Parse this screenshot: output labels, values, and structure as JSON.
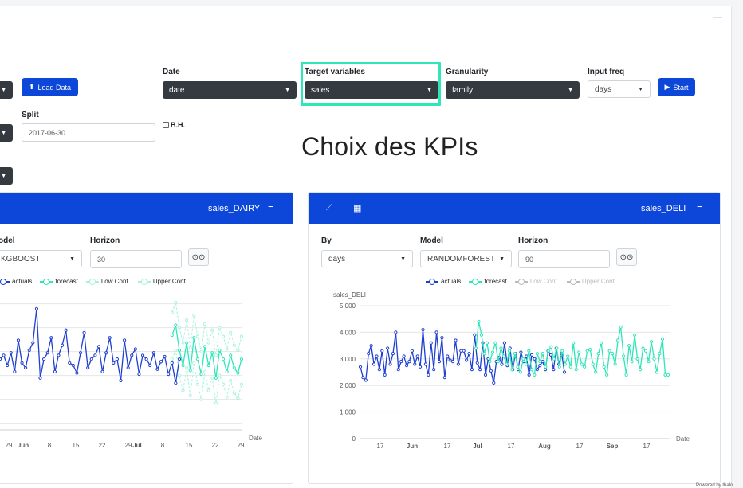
{
  "controls": {
    "load_button": "Load Data",
    "date_label": "Date",
    "date_value": "date",
    "target_label": "Target variables",
    "target_value": "sales",
    "granularity_label": "Granularity",
    "granularity_value": "family",
    "input_freq_label": "Input freq",
    "input_freq_value": "days",
    "start_button": "Start",
    "split_label": "Split",
    "split_value": "2017-06-30",
    "bh_label": "B.H."
  },
  "annotation": "Choix des KPIs",
  "left_panel": {
    "title": "sales_DAIRY",
    "model_label": "odel",
    "model_value": "KGBOOST",
    "horizon_label": "Horizon",
    "horizon_value": "30",
    "legend": [
      "actuals",
      "forecast",
      "Low Conf.",
      "Upper Conf."
    ],
    "x_ticks": [
      "29",
      "Jun",
      "8",
      "15",
      "22",
      "29",
      "Jul",
      "8",
      "15",
      "22",
      "29"
    ],
    "x_axis_title": "Date"
  },
  "right_panel": {
    "title": "sales_DELI",
    "by_label": "By",
    "by_value": "days",
    "model_label": "Model",
    "model_value": "RANDOMFOREST",
    "horizon_label": "Horizon",
    "horizon_value": "90",
    "legend": [
      "actuals",
      "forecast",
      "Low Conf.",
      "Upper Conf."
    ],
    "y_axis_title": "sales_DELI",
    "y_ticks": [
      "5,000",
      "4,000",
      "3,000",
      "2,000",
      "1,000",
      "0"
    ],
    "x_ticks": [
      "17",
      "Jun",
      "17",
      "Jul",
      "17",
      "Aug",
      "17",
      "Sep",
      "17"
    ],
    "x_axis_title": "Date"
  },
  "footer": {
    "powered_by": "Powered by thalo"
  },
  "colors": {
    "accent": "#0d47d9",
    "actuals": "#1f3fd1",
    "forecast": "#2ee6b8",
    "conf": "#a8f2dd",
    "conf_grey": "#bbbbbb"
  },
  "chart_data": [
    {
      "type": "line",
      "title": "sales_DAIRY",
      "xlabel": "Date",
      "series": [
        {
          "name": "actuals",
          "values": [
            0.55,
            0.58,
            0.5,
            0.6,
            0.45,
            0.7,
            0.52,
            0.48,
            0.62,
            0.68,
            0.95,
            0.4,
            0.55,
            0.6,
            0.72,
            0.45,
            0.58,
            0.66,
            0.78,
            0.52,
            0.5,
            0.44,
            0.6,
            0.76,
            0.48,
            0.55,
            0.58,
            0.65,
            0.45,
            0.6,
            0.72,
            0.52,
            0.55,
            0.38,
            0.7,
            0.48,
            0.58,
            0.63,
            0.43,
            0.58,
            0.55,
            0.5,
            0.6,
            0.47,
            0.53,
            0.57,
            0.43,
            0.52,
            0.36,
            0.55
          ]
        },
        {
          "name": "forecast",
          "values": [
            0.74,
            0.82,
            0.62,
            0.5,
            0.68,
            0.46,
            0.72,
            0.55,
            0.43,
            0.65,
            0.5,
            0.6,
            0.4,
            0.62,
            0.55,
            0.45,
            0.58,
            0.48,
            0.44,
            0.55
          ]
        },
        {
          "name": "Low Conf.",
          "values": [
            0.55,
            0.62,
            0.42,
            0.3,
            0.48,
            0.26,
            0.52,
            0.35,
            0.23,
            0.45,
            0.3,
            0.4,
            0.2,
            0.42,
            0.35,
            0.25,
            0.38,
            0.28,
            0.24,
            0.35
          ]
        },
        {
          "name": "Upper Conf.",
          "values": [
            0.92,
            1.0,
            0.8,
            0.68,
            0.86,
            0.64,
            0.9,
            0.73,
            0.61,
            0.83,
            0.68,
            0.78,
            0.58,
            0.8,
            0.73,
            0.63,
            0.76,
            0.66,
            0.62,
            0.73
          ]
        }
      ]
    },
    {
      "type": "line",
      "title": "sales_DELI",
      "ylabel": "sales_DELI",
      "xlabel": "Date",
      "ylim": [
        0,
        5000
      ],
      "series": [
        {
          "name": "actuals",
          "values": [
            2700,
            2300,
            2200,
            3200,
            3500,
            2800,
            3100,
            2600,
            3300,
            2400,
            3400,
            2800,
            3200,
            4000,
            2600,
            2900,
            3100,
            2750,
            2900,
            3300,
            2800,
            3100,
            2700,
            4100,
            2800,
            2400,
            3600,
            2600,
            4000,
            2900,
            3800,
            2300,
            3100,
            2950,
            2900,
            3700,
            2800,
            3300,
            3300,
            2950,
            3200,
            2600,
            3900,
            2850,
            2600,
            3600,
            2400,
            3000,
            2550,
            2100,
            2900,
            3050,
            2800,
            3600,
            2750,
            3400,
            2600,
            3200,
            2600,
            3250,
            2900,
            3100,
            2400,
            3150,
            3000,
            2600,
            2750,
            2900,
            2600,
            3300,
            3150,
            2600,
            3400,
            2800,
            3200,
            2500
          ]
        },
        {
          "name": "forecast",
          "values": [
            3400,
            4400,
            3900,
            3200,
            3600,
            2900,
            3250,
            3600,
            2900,
            3400,
            3100,
            2800,
            3300,
            2600,
            3200,
            2700,
            2500,
            3000,
            2800,
            3300,
            2600,
            2400,
            3200,
            2900,
            3200,
            2700,
            3300,
            3450,
            3000,
            3400,
            2700,
            3300,
            2800,
            3100,
            2700,
            3600,
            2600,
            3250,
            2800,
            2700,
            3300,
            3350,
            2800,
            2500,
            3200,
            3600,
            2700,
            2400,
            3300,
            3200,
            2800,
            3700,
            4200,
            3100,
            2400,
            3500,
            2900,
            3900,
            3000,
            2600,
            3400,
            3300,
            2900,
            3650,
            3000,
            2500,
            3200,
            3750,
            2400,
            2400
          ]
        }
      ]
    }
  ]
}
